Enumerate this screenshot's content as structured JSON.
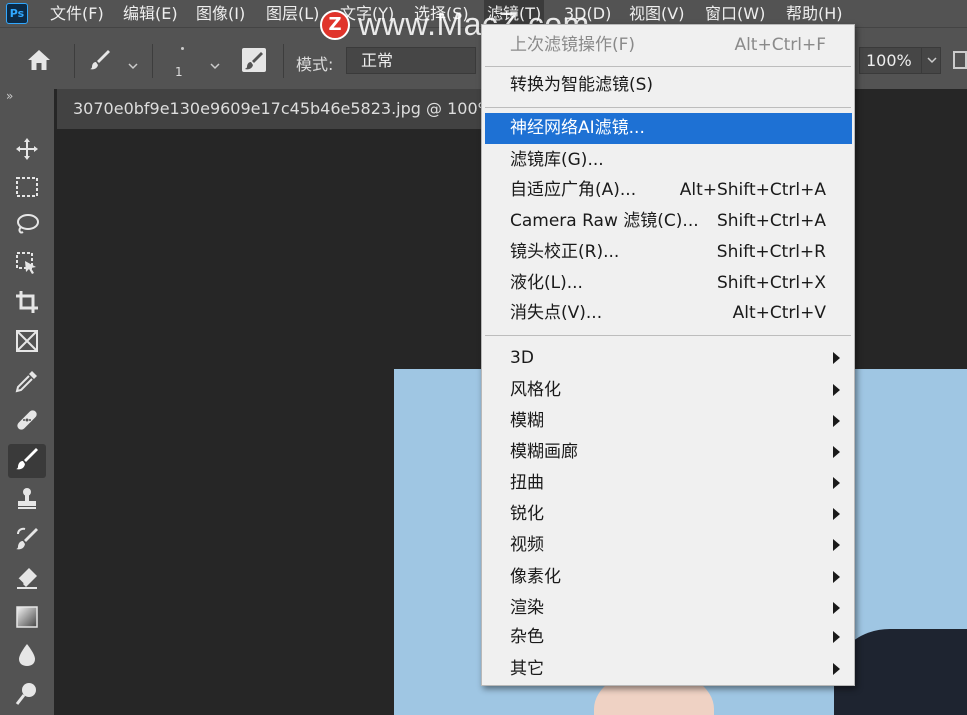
{
  "app": {
    "logo": "Ps"
  },
  "menubar": {
    "items": [
      "文件(F)",
      "编辑(E)",
      "图像(I)",
      "图层(L)",
      "文字(Y)",
      "选择(S)",
      "滤镜(T)",
      "3D(D)",
      "视图(V)",
      "窗口(W)",
      "帮助(H)"
    ],
    "active": "滤镜(T)"
  },
  "watermark": {
    "logo_letter": "Z",
    "text": "www.MacZ.com"
  },
  "options": {
    "brush_size": "1",
    "mode_label": "模式:",
    "mode_value": "正常",
    "zoom_value": "100%"
  },
  "toolbar": {
    "collapse": "»",
    "tools": [
      "move-icon",
      "marquee-icon",
      "lasso-icon",
      "object-select-icon",
      "crop-icon",
      "frame-icon",
      "eyedropper-icon",
      "healing-icon",
      "brush-icon",
      "stamp-icon",
      "history-brush-icon",
      "eraser-icon",
      "gradient-icon",
      "blur-icon",
      "dodge-icon"
    ],
    "active_tool": "brush-icon"
  },
  "document": {
    "tab_title": "3070e0bf9e130e9609e17c45b46e5823.jpg @ 100%("
  },
  "filter_menu": {
    "last_filter": {
      "label": "上次滤镜操作(F)",
      "shortcut": "Alt+Ctrl+F",
      "enabled": false
    },
    "smart": {
      "label": "转换为智能滤镜(S)"
    },
    "neural": {
      "label": "神经网络AI滤镜...",
      "highlighted": true
    },
    "group_items": [
      {
        "label": "滤镜库(G)...",
        "shortcut": ""
      },
      {
        "label": "自适应广角(A)...",
        "shortcut": "Alt+Shift+Ctrl+A"
      },
      {
        "label": "Camera Raw 滤镜(C)...",
        "shortcut": "Shift+Ctrl+A"
      },
      {
        "label": "镜头校正(R)...",
        "shortcut": "Shift+Ctrl+R"
      },
      {
        "label": "液化(L)...",
        "shortcut": "Shift+Ctrl+X"
      },
      {
        "label": "消失点(V)...",
        "shortcut": "Alt+Ctrl+V"
      }
    ],
    "submenus": [
      "3D",
      "风格化",
      "模糊",
      "模糊画廊",
      "扭曲",
      "锐化",
      "视频",
      "像素化",
      "渲染",
      "杂色",
      "其它"
    ]
  },
  "colors": {
    "panel": "#535353",
    "canvas_bg": "#262626",
    "menu_bg": "#f0f0f0",
    "highlight": "#1e71d4",
    "photo_bg": "#9fc6e3"
  }
}
